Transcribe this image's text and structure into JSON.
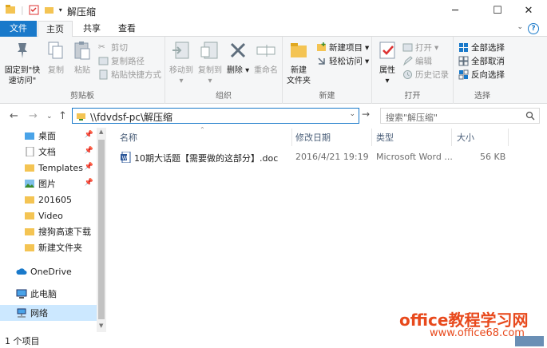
{
  "window": {
    "title": "解压缩"
  },
  "tabs": [
    {
      "label": "文件"
    },
    {
      "label": "主页"
    },
    {
      "label": "共享"
    },
    {
      "label": "查看"
    }
  ],
  "ribbon": {
    "clipboard": {
      "label": "剪贴板",
      "pin": "固定到\"快速访问\"",
      "copy": "复制",
      "paste": "粘贴",
      "cut": "剪切",
      "copy_path": "复制路径",
      "paste_shortcut": "粘贴快捷方式"
    },
    "organize": {
      "label": "组织",
      "move_to": "移动到",
      "copy_to": "复制到",
      "delete": "删除",
      "rename": "重命名"
    },
    "new": {
      "label": "新建",
      "new_folder": "新建\n文件夹",
      "new_item": "新建项目",
      "easy_access": "轻松访问"
    },
    "open": {
      "label": "打开",
      "properties": "属性",
      "open": "打开",
      "edit": "编辑",
      "history": "历史记录"
    },
    "select": {
      "label": "选择",
      "select_all": "全部选择",
      "select_none": "全部取消",
      "invert": "反向选择"
    }
  },
  "address": {
    "path": "\\\\fdvdsf-pc\\解压缩"
  },
  "search": {
    "placeholder": "搜索\"解压缩\""
  },
  "nav_pane": [
    {
      "label": "桌面",
      "pinned": true
    },
    {
      "label": "文档",
      "pinned": true
    },
    {
      "label": "Templates",
      "pinned": true
    },
    {
      "label": "图片",
      "pinned": true
    },
    {
      "label": "201605",
      "pinned": false
    },
    {
      "label": "Video",
      "pinned": false
    },
    {
      "label": "搜狗高速下载",
      "pinned": false
    },
    {
      "label": "新建文件夹",
      "pinned": false
    },
    {
      "label": "OneDrive",
      "pinned": false
    },
    {
      "label": "此电脑",
      "pinned": false
    },
    {
      "label": "网络",
      "pinned": false,
      "selected": true
    }
  ],
  "columns": {
    "name": "名称",
    "modified": "修改日期",
    "type": "类型",
    "size": "大小"
  },
  "files": [
    {
      "name": "10期大话题【需要做的这部分】.doc",
      "modified": "2016/4/21 19:19",
      "type": "Microsoft Word ...",
      "size": "56 KB"
    }
  ],
  "status": {
    "text": "1 个项目"
  },
  "watermark": {
    "line1": "office教程学习网",
    "line2": "www.office68.com"
  },
  "colors": {
    "accent": "#1979ca",
    "selected": "#cce8ff",
    "folder": "#f4c453",
    "watermark": "#e8491c"
  }
}
